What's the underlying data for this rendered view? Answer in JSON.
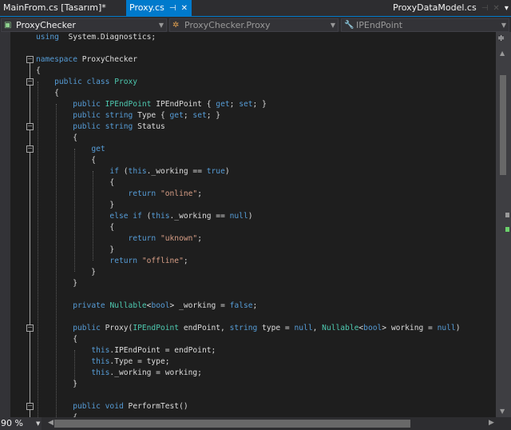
{
  "tabs": [
    {
      "label": "MainFrom.cs [Tasarım]*",
      "active": false
    },
    {
      "label": "Proxy.cs",
      "active": true,
      "pin_icon": "pin-icon",
      "close_icon": "close-icon"
    },
    {
      "label": "ProxyDataModel.cs",
      "active": false
    }
  ],
  "nav": {
    "project": "ProxyChecker",
    "class": "ProxyChecker.Proxy",
    "member": "IPEndPoint"
  },
  "zoom_level": "90 %",
  "colors": {
    "keyword": "#569cd6",
    "type": "#4ec9b0",
    "string": "#d69d85",
    "text": "#dcdcdc",
    "background": "#1e1e1e",
    "accent": "#007acc"
  },
  "code_lines": [
    [
      [
        "kw",
        "using"
      ],
      [
        "",
        "  System.Diagnostics;"
      ]
    ],
    [],
    [
      [
        "kw",
        "namespace"
      ],
      [
        "",
        " ProxyChecker"
      ]
    ],
    [
      [
        "",
        "{"
      ]
    ],
    [
      [
        "",
        "    "
      ],
      [
        "kw",
        "public class"
      ],
      [
        "",
        " "
      ],
      [
        "ty",
        "Proxy"
      ]
    ],
    [
      [
        "",
        "    {"
      ]
    ],
    [
      [
        "",
        "        "
      ],
      [
        "kw",
        "public"
      ],
      [
        "",
        " "
      ],
      [
        "ty",
        "IPEndPoint"
      ],
      [
        "",
        " IPEndPoint { "
      ],
      [
        "kw",
        "get"
      ],
      [
        "",
        "; "
      ],
      [
        "kw",
        "set"
      ],
      [
        "",
        "; }"
      ]
    ],
    [
      [
        "",
        "        "
      ],
      [
        "kw",
        "public string"
      ],
      [
        "",
        " Type { "
      ],
      [
        "kw",
        "get"
      ],
      [
        "",
        "; "
      ],
      [
        "kw",
        "set"
      ],
      [
        "",
        "; }"
      ]
    ],
    [
      [
        "",
        "        "
      ],
      [
        "kw",
        "public string"
      ],
      [
        "",
        " Status"
      ]
    ],
    [
      [
        "",
        "        {"
      ]
    ],
    [
      [
        "",
        "            "
      ],
      [
        "kw",
        "get"
      ]
    ],
    [
      [
        "",
        "            {"
      ]
    ],
    [
      [
        "",
        "                "
      ],
      [
        "kw",
        "if"
      ],
      [
        "",
        " ("
      ],
      [
        "kw",
        "this"
      ],
      [
        "",
        "._working == "
      ],
      [
        "kw",
        "true"
      ],
      [
        "",
        ")"
      ]
    ],
    [
      [
        "",
        "                {"
      ]
    ],
    [
      [
        "",
        "                    "
      ],
      [
        "kw",
        "return"
      ],
      [
        "",
        " "
      ],
      [
        "st",
        "\"online\""
      ],
      [
        "",
        ";"
      ]
    ],
    [
      [
        "",
        "                }"
      ]
    ],
    [
      [
        "",
        "                "
      ],
      [
        "kw",
        "else if"
      ],
      [
        "",
        " ("
      ],
      [
        "kw",
        "this"
      ],
      [
        "",
        "._working == "
      ],
      [
        "kw",
        "null"
      ],
      [
        "",
        ")"
      ]
    ],
    [
      [
        "",
        "                {"
      ]
    ],
    [
      [
        "",
        "                    "
      ],
      [
        "kw",
        "return"
      ],
      [
        "",
        " "
      ],
      [
        "st",
        "\"uknown\""
      ],
      [
        "",
        ";"
      ]
    ],
    [
      [
        "",
        "                }"
      ]
    ],
    [
      [
        "",
        "                "
      ],
      [
        "kw",
        "return"
      ],
      [
        "",
        " "
      ],
      [
        "st",
        "\"offline\""
      ],
      [
        "",
        ";"
      ]
    ],
    [
      [
        "",
        "            }"
      ]
    ],
    [
      [
        "",
        "        }"
      ]
    ],
    [],
    [
      [
        "",
        "        "
      ],
      [
        "kw",
        "private"
      ],
      [
        "",
        " "
      ],
      [
        "ty",
        "Nullable"
      ],
      [
        "",
        "<"
      ],
      [
        "kw",
        "bool"
      ],
      [
        "",
        "> _working = "
      ],
      [
        "kw",
        "false"
      ],
      [
        "",
        ";"
      ]
    ],
    [],
    [
      [
        "",
        "        "
      ],
      [
        "kw",
        "public"
      ],
      [
        "",
        " Proxy("
      ],
      [
        "ty",
        "IPEndPoint"
      ],
      [
        "",
        " endPoint, "
      ],
      [
        "kw",
        "string"
      ],
      [
        "",
        " type = "
      ],
      [
        "kw",
        "null"
      ],
      [
        "",
        ", "
      ],
      [
        "ty",
        "Nullable"
      ],
      [
        "",
        "<"
      ],
      [
        "kw",
        "bool"
      ],
      [
        "",
        "> working = "
      ],
      [
        "kw",
        "null"
      ],
      [
        "",
        ")"
      ]
    ],
    [
      [
        "",
        "        {"
      ]
    ],
    [
      [
        "",
        "            "
      ],
      [
        "kw",
        "this"
      ],
      [
        "",
        ".IPEndPoint = endPoint;"
      ]
    ],
    [
      [
        "",
        "            "
      ],
      [
        "kw",
        "this"
      ],
      [
        "",
        ".Type = type;"
      ]
    ],
    [
      [
        "",
        "            "
      ],
      [
        "kw",
        "this"
      ],
      [
        "",
        "._working = working;"
      ]
    ],
    [
      [
        "",
        "        }"
      ]
    ],
    [],
    [
      [
        "",
        "        "
      ],
      [
        "kw",
        "public void"
      ],
      [
        "",
        " PerformTest()"
      ]
    ],
    [
      [
        "",
        "        {"
      ]
    ]
  ]
}
